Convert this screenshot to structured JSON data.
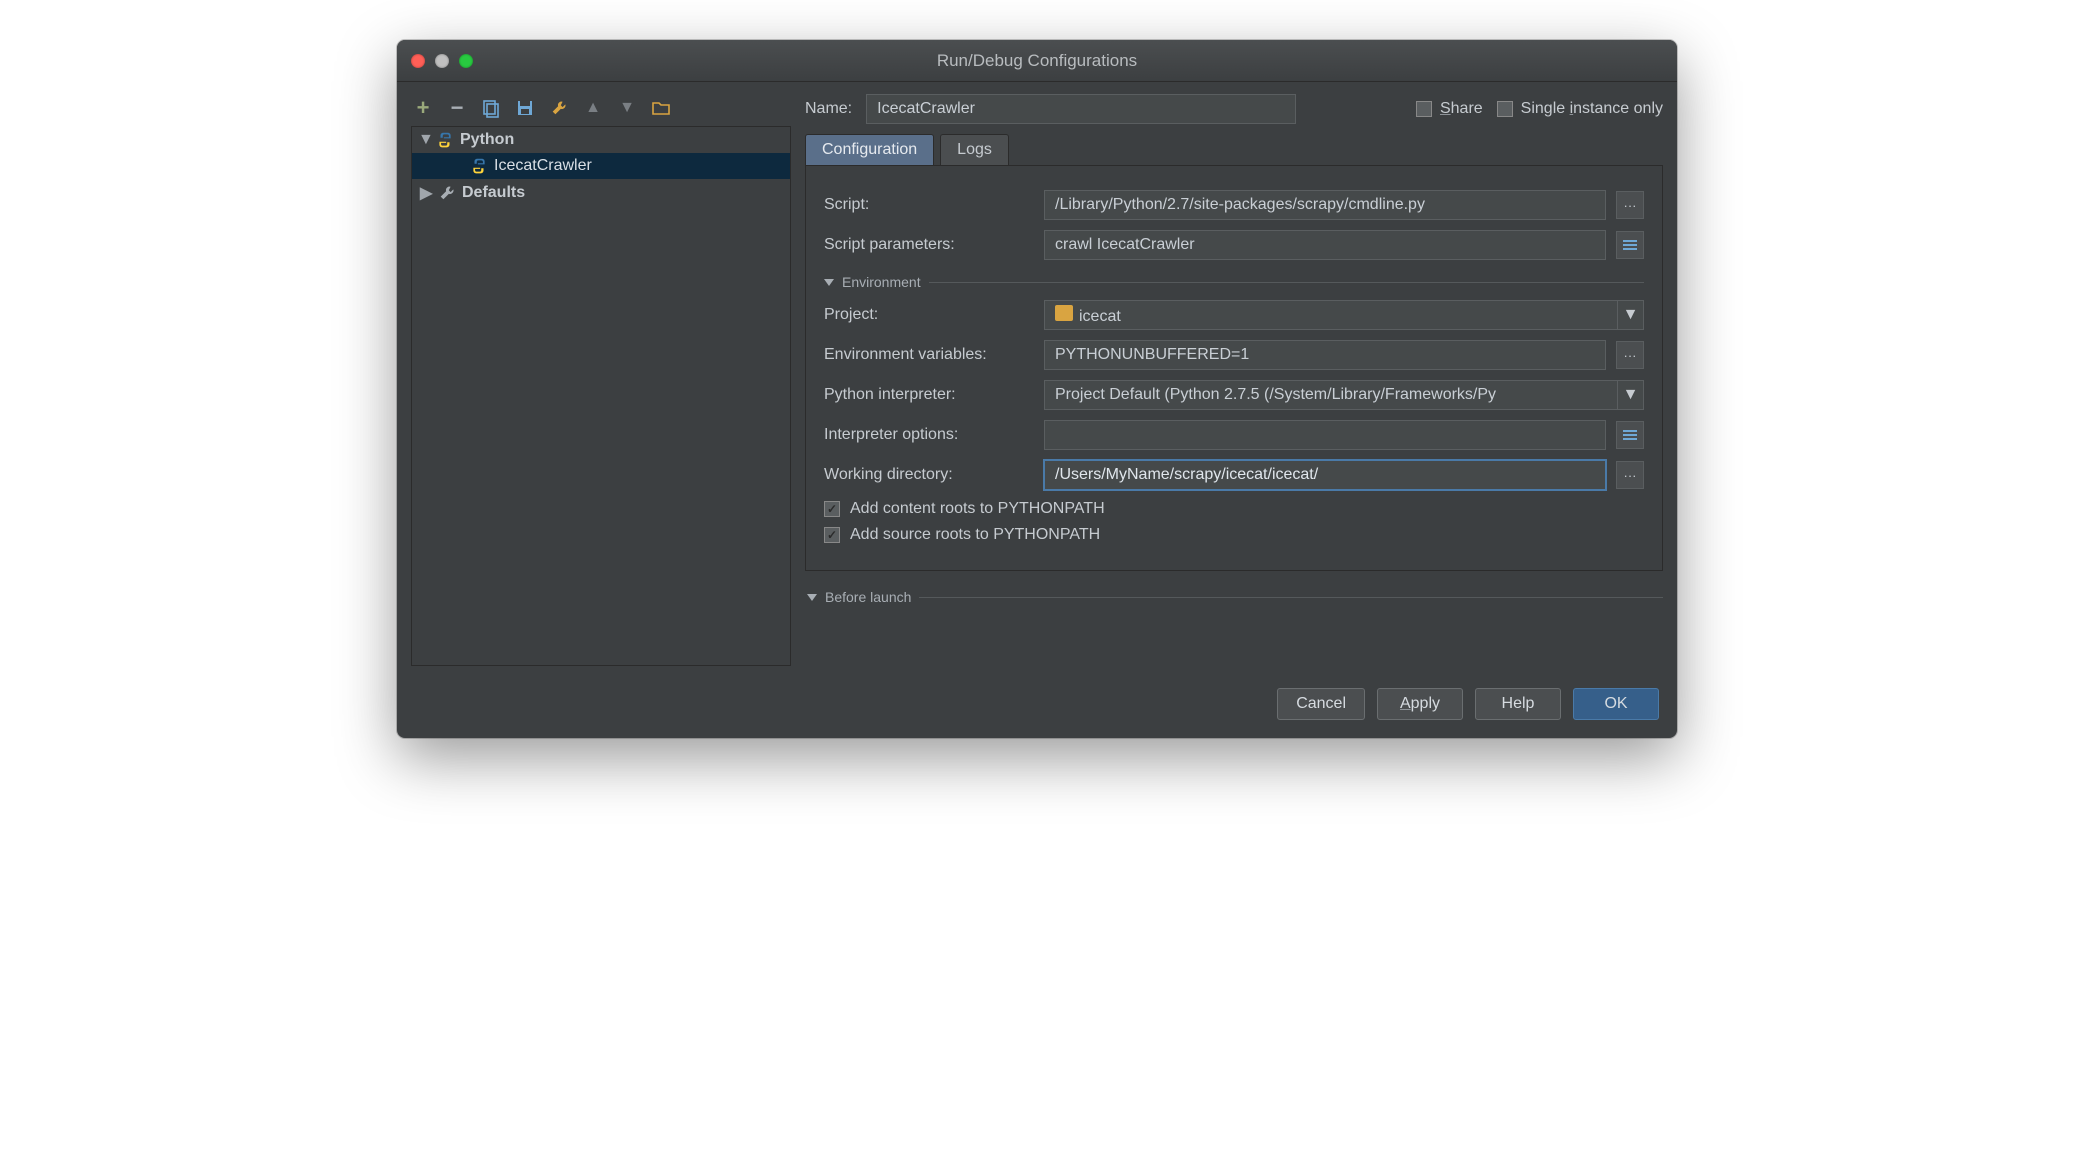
{
  "window": {
    "title": "Run/Debug Configurations"
  },
  "tree": {
    "root_python": "Python",
    "config_name": "IcecatCrawler",
    "defaults": "Defaults"
  },
  "header": {
    "name_label": "Name:",
    "name_value": "IcecatCrawler",
    "share_label": "Share",
    "single_label": "Single instance only"
  },
  "tabs": {
    "configuration": "Configuration",
    "logs": "Logs"
  },
  "form": {
    "script_label": "Script:",
    "script_value": "/Library/Python/2.7/site-packages/scrapy/cmdline.py",
    "params_label": "Script parameters:",
    "params_value": "crawl IcecatCrawler",
    "env_section": "Environment",
    "project_label": "Project:",
    "project_value": "icecat",
    "envvars_label": "Environment variables:",
    "envvars_value": "PYTHONUNBUFFERED=1",
    "interp_label": "Python interpreter:",
    "interp_value": "Project Default (Python 2.7.5 (/System/Library/Frameworks/Py",
    "interp_opts_label": "Interpreter options:",
    "interp_opts_value": "",
    "workdir_label": "Working directory:",
    "workdir_value": "/Users/MyName/scrapy/icecat/icecat/",
    "add_content_roots": "Add content roots to PYTHONPATH",
    "add_source_roots": "Add source roots to PYTHONPATH",
    "before_launch": "Before launch"
  },
  "buttons": {
    "cancel": "Cancel",
    "apply": "Apply",
    "help": "Help",
    "ok": "OK"
  }
}
